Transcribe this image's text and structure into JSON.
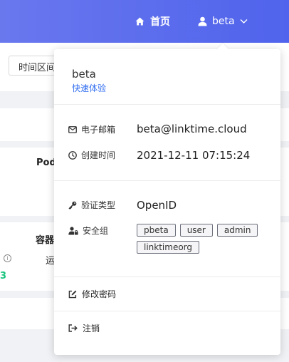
{
  "header": {
    "home_label": "首页",
    "user_label": "beta"
  },
  "background": {
    "time_range_label": "时间区间",
    "pod_label": "Pod",
    "container_label": "容器",
    "run_label": "运",
    "green_value": "3"
  },
  "dropdown": {
    "username": "beta",
    "quick_link": "快速体验",
    "email": {
      "label": "电子邮箱",
      "value": "beta@linktime.cloud"
    },
    "created": {
      "label": "创建时间",
      "value": "2021-12-11 07:15:24"
    },
    "auth": {
      "label": "验证类型",
      "value": "OpenID"
    },
    "groups": {
      "label": "安全组",
      "tags": [
        "pbeta",
        "user",
        "admin",
        "linktimeorg"
      ]
    },
    "change_password": "修改密码",
    "logout": "注销"
  },
  "colors": {
    "header_gradient_start": "#6a78ee",
    "header_gradient_end": "#4f63ec",
    "link": "#3470f0",
    "accent_green": "#19c37d"
  },
  "icons": [
    "home-icon",
    "user-icon",
    "chevron-down-icon",
    "email-icon",
    "clock-icon",
    "key-icon",
    "user-lock-icon",
    "edit-icon",
    "logout-icon",
    "info-icon"
  ]
}
